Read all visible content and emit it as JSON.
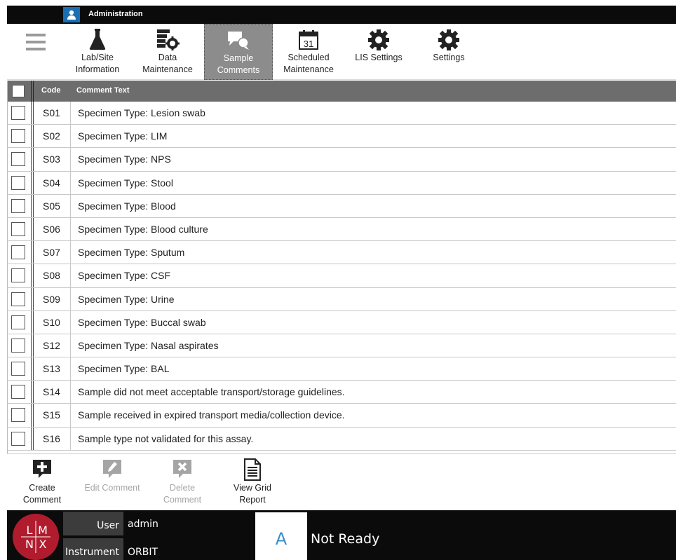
{
  "window": {
    "title": "Administration"
  },
  "toolbar": {
    "menu_icon": "hamburger-menu-icon",
    "tabs": [
      {
        "line1": "Lab/Site",
        "line2": "Information",
        "icon": "flask-icon",
        "active": false
      },
      {
        "line1": "Data",
        "line2": "Maintenance",
        "icon": "database-gear-icon",
        "active": false
      },
      {
        "line1": "Sample",
        "line2": "Comments",
        "icon": "comments-icon",
        "active": true
      },
      {
        "line1": "Scheduled",
        "line2": "Maintenance",
        "icon": "calendar-icon",
        "active": false,
        "calendar_day": "31"
      },
      {
        "line1": "LIS Settings",
        "line2": "",
        "icon": "gear-icon",
        "active": false
      },
      {
        "line1": "Settings",
        "line2": "",
        "icon": "gear-icon",
        "active": false
      }
    ]
  },
  "grid": {
    "headers": {
      "code": "Code",
      "text": "Comment Text"
    },
    "rows": [
      {
        "code": "S01",
        "text": "Specimen Type: Lesion swab"
      },
      {
        "code": "S02",
        "text": "Specimen Type: LIM"
      },
      {
        "code": "S03",
        "text": "Specimen Type: NPS"
      },
      {
        "code": "S04",
        "text": "Specimen Type: Stool"
      },
      {
        "code": "S05",
        "text": "Specimen Type: Blood"
      },
      {
        "code": "S06",
        "text": "Specimen Type: Blood culture"
      },
      {
        "code": "S07",
        "text": "Specimen Type: Sputum"
      },
      {
        "code": "S08",
        "text": "Specimen Type: CSF"
      },
      {
        "code": "S09",
        "text": "Specimen Type: Urine"
      },
      {
        "code": "S10",
        "text": "Specimen Type: Buccal swab"
      },
      {
        "code": "S12",
        "text": "Specimen Type: Nasal aspirates"
      },
      {
        "code": "S13",
        "text": "Specimen Type: BAL"
      },
      {
        "code": "S14",
        "text": "Sample did not meet acceptable transport/storage guidelines."
      },
      {
        "code": "S15",
        "text": "Sample received in expired transport media/collection device."
      },
      {
        "code": "S16",
        "text": "Sample type not validated for this assay."
      }
    ]
  },
  "actions": [
    {
      "line1": "Create",
      "line2": "Comment",
      "icon": "add-comment-icon",
      "enabled": true
    },
    {
      "line1": "Edit Comment",
      "line2": "",
      "icon": "edit-comment-icon",
      "enabled": false
    },
    {
      "line1": "Delete",
      "line2": "Comment",
      "icon": "delete-comment-icon",
      "enabled": false
    },
    {
      "line1": "View Grid",
      "line2": "Report",
      "icon": "report-icon",
      "enabled": true
    }
  ],
  "status": {
    "logo": {
      "letters": [
        "L",
        "M",
        "N",
        "X"
      ]
    },
    "user_label": "User",
    "user_value": "admin",
    "instrument_label": "Instrument",
    "instrument_value": "ORBIT",
    "state_letter": "A",
    "state_text": "Not Ready"
  },
  "colors": {
    "title_bar": "#0b0b0b",
    "active_tab": "#8c8c8c",
    "grid_header": "#6d6d6d",
    "logo": "#b01c2e",
    "state_letter": "#3a8fc9"
  }
}
